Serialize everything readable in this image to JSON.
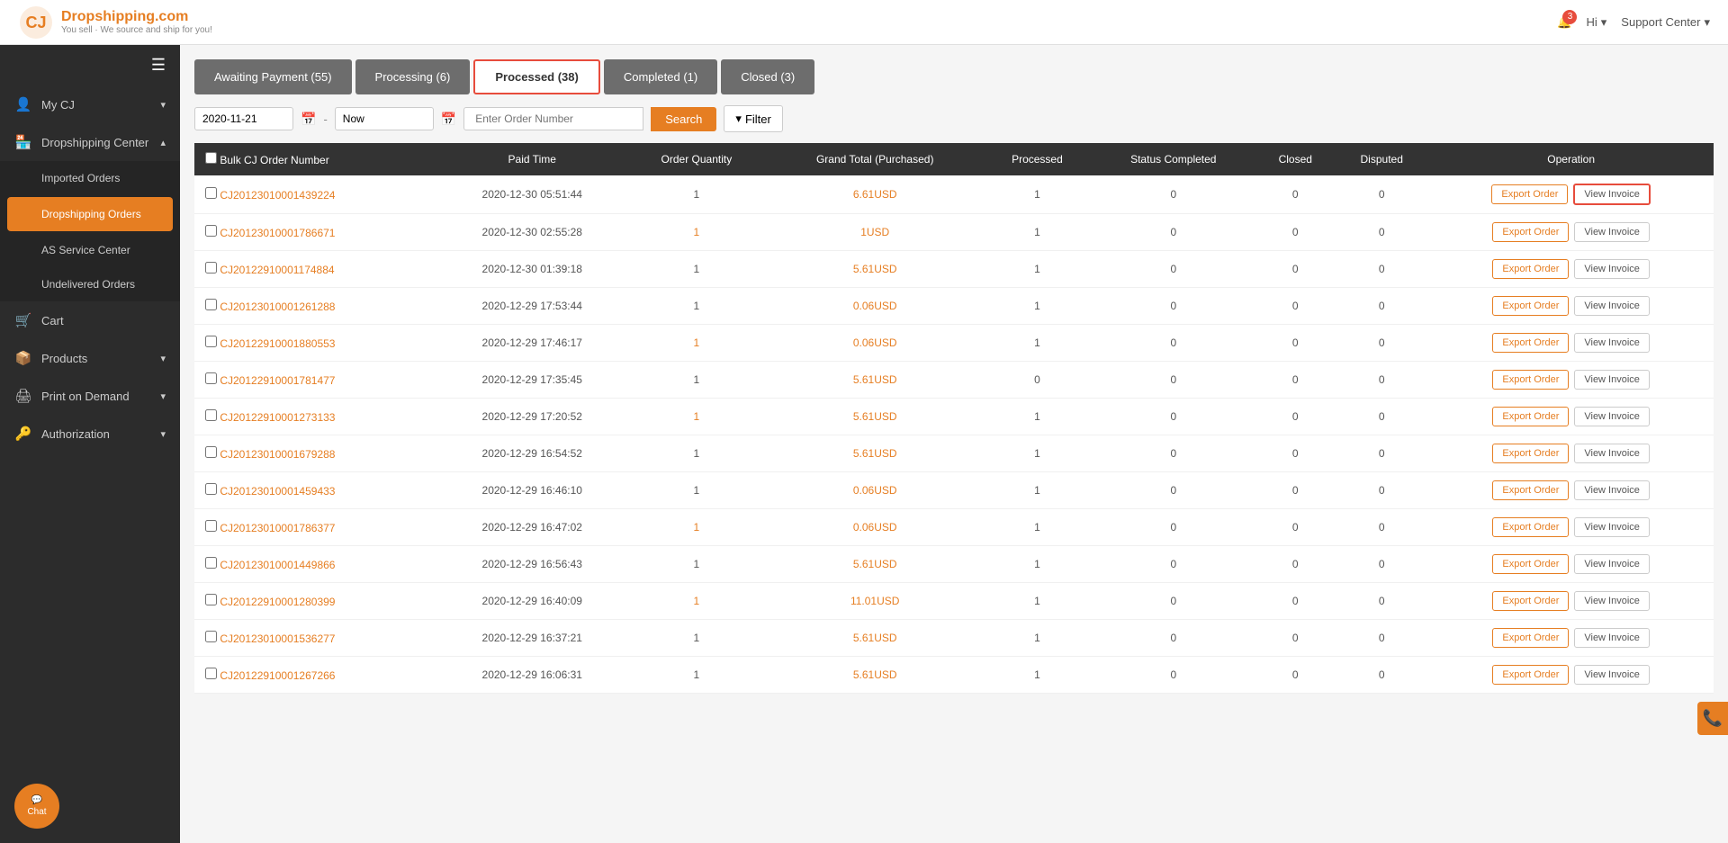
{
  "topNav": {
    "logoTitle": "Dropshipping.com",
    "logoSubtitle": "You sell · We source and ship for you!",
    "bellCount": "3",
    "userLabel": "Hi",
    "supportLabel": "Support Center"
  },
  "sidebar": {
    "hamburgerIcon": "☰",
    "items": [
      {
        "id": "my-cj",
        "icon": "👤",
        "label": "My CJ",
        "hasArrow": true
      },
      {
        "id": "dropshipping-center",
        "icon": "🏪",
        "label": "Dropshipping Center",
        "hasArrow": true,
        "expanded": true,
        "children": [
          {
            "id": "imported-orders",
            "label": "Imported Orders"
          },
          {
            "id": "dropshipping-orders",
            "label": "Dropshipping Orders",
            "active": true
          },
          {
            "id": "as-service-center",
            "label": "AS Service Center"
          },
          {
            "id": "undelivered-orders",
            "label": "Undelivered Orders"
          }
        ]
      },
      {
        "id": "cart",
        "icon": "🛒",
        "label": "Cart"
      },
      {
        "id": "products",
        "icon": "📦",
        "label": "Products",
        "hasArrow": true
      },
      {
        "id": "print-on-demand",
        "icon": "🖨",
        "label": "Print on Demand",
        "hasArrow": true
      },
      {
        "id": "authorization",
        "icon": "🔑",
        "label": "Authorization",
        "hasArrow": true
      }
    ],
    "chatLabel": "Chat"
  },
  "tabs": [
    {
      "id": "awaiting-payment",
      "label": "Awaiting Payment (55)",
      "active": false
    },
    {
      "id": "processing",
      "label": "Processing (6)",
      "active": false
    },
    {
      "id": "processed",
      "label": "Processed (38)",
      "active": true
    },
    {
      "id": "completed",
      "label": "Completed (1)",
      "active": false
    },
    {
      "id": "closed",
      "label": "Closed (3)",
      "active": false
    }
  ],
  "filterBar": {
    "dateFrom": "2020-11-21",
    "dateTo": "Now",
    "orderPlaceholder": "Enter Order Number",
    "searchLabel": "Search",
    "filterLabel": "Filter"
  },
  "table": {
    "columns": [
      "Bulk CJ Order Number",
      "Paid Time",
      "Order Quantity",
      "Grand Total (Purchased)",
      "Processed",
      "Status Completed",
      "Closed",
      "Disputed",
      "Operation"
    ],
    "rows": [
      {
        "id": "CJ20123010001439224",
        "paidTime": "2020-12-30 05:51:44",
        "qty": "1",
        "qtyHighlight": false,
        "total": "6.61USD",
        "processed": "1",
        "completed": "0",
        "closed": "0",
        "disputed": "0",
        "invoiceHighlight": true
      },
      {
        "id": "CJ20123010001786671",
        "paidTime": "2020-12-30 02:55:28",
        "qty": "1",
        "qtyHighlight": true,
        "total": "1USD",
        "processed": "1",
        "completed": "0",
        "closed": "0",
        "disputed": "0",
        "invoiceHighlight": false
      },
      {
        "id": "CJ20122910001174884",
        "paidTime": "2020-12-30 01:39:18",
        "qty": "1",
        "qtyHighlight": false,
        "total": "5.61USD",
        "processed": "1",
        "completed": "0",
        "closed": "0",
        "disputed": "0",
        "invoiceHighlight": false
      },
      {
        "id": "CJ20123010001261288",
        "paidTime": "2020-12-29 17:53:44",
        "qty": "1",
        "qtyHighlight": false,
        "total": "0.06USD",
        "processed": "1",
        "completed": "0",
        "closed": "0",
        "disputed": "0",
        "invoiceHighlight": false
      },
      {
        "id": "CJ20122910001880553",
        "paidTime": "2020-12-29 17:46:17",
        "qty": "1",
        "qtyHighlight": true,
        "total": "0.06USD",
        "processed": "1",
        "completed": "0",
        "closed": "0",
        "disputed": "0",
        "invoiceHighlight": false
      },
      {
        "id": "CJ20122910001781477",
        "paidTime": "2020-12-29 17:35:45",
        "qty": "1",
        "qtyHighlight": false,
        "total": "5.61USD",
        "processed": "0",
        "completed": "0",
        "closed": "0",
        "disputed": "0",
        "invoiceHighlight": false
      },
      {
        "id": "CJ20122910001273133",
        "paidTime": "2020-12-29 17:20:52",
        "qty": "1",
        "qtyHighlight": true,
        "total": "5.61USD",
        "processed": "1",
        "completed": "0",
        "closed": "0",
        "disputed": "0",
        "invoiceHighlight": false
      },
      {
        "id": "CJ20123010001679288",
        "paidTime": "2020-12-29 16:54:52",
        "qty": "1",
        "qtyHighlight": false,
        "total": "5.61USD",
        "processed": "1",
        "completed": "0",
        "closed": "0",
        "disputed": "0",
        "invoiceHighlight": false
      },
      {
        "id": "CJ20123010001459433",
        "paidTime": "2020-12-29 16:46:10",
        "qty": "1",
        "qtyHighlight": false,
        "total": "0.06USD",
        "processed": "1",
        "completed": "0",
        "closed": "0",
        "disputed": "0",
        "invoiceHighlight": false
      },
      {
        "id": "CJ20123010001786377",
        "paidTime": "2020-12-29 16:47:02",
        "qty": "1",
        "qtyHighlight": true,
        "total": "0.06USD",
        "processed": "1",
        "completed": "0",
        "closed": "0",
        "disputed": "0",
        "invoiceHighlight": false
      },
      {
        "id": "CJ20123010001449866",
        "paidTime": "2020-12-29 16:56:43",
        "qty": "1",
        "qtyHighlight": false,
        "total": "5.61USD",
        "processed": "1",
        "completed": "0",
        "closed": "0",
        "disputed": "0",
        "invoiceHighlight": false
      },
      {
        "id": "CJ20122910001280399",
        "paidTime": "2020-12-29 16:40:09",
        "qty": "1",
        "qtyHighlight": true,
        "total": "11.01USD",
        "processed": "1",
        "completed": "0",
        "closed": "0",
        "disputed": "0",
        "invoiceHighlight": false
      },
      {
        "id": "CJ20123010001536277",
        "paidTime": "2020-12-29 16:37:21",
        "qty": "1",
        "qtyHighlight": false,
        "total": "5.61USD",
        "processed": "1",
        "completed": "0",
        "closed": "0",
        "disputed": "0",
        "invoiceHighlight": false
      },
      {
        "id": "CJ20122910001267266",
        "paidTime": "2020-12-29 16:06:31",
        "qty": "1",
        "qtyHighlight": false,
        "total": "5.61USD",
        "processed": "1",
        "completed": "0",
        "closed": "0",
        "disputed": "0",
        "invoiceHighlight": false
      }
    ],
    "exportLabel": "Export Order",
    "invoiceLabel": "View Invoice"
  }
}
